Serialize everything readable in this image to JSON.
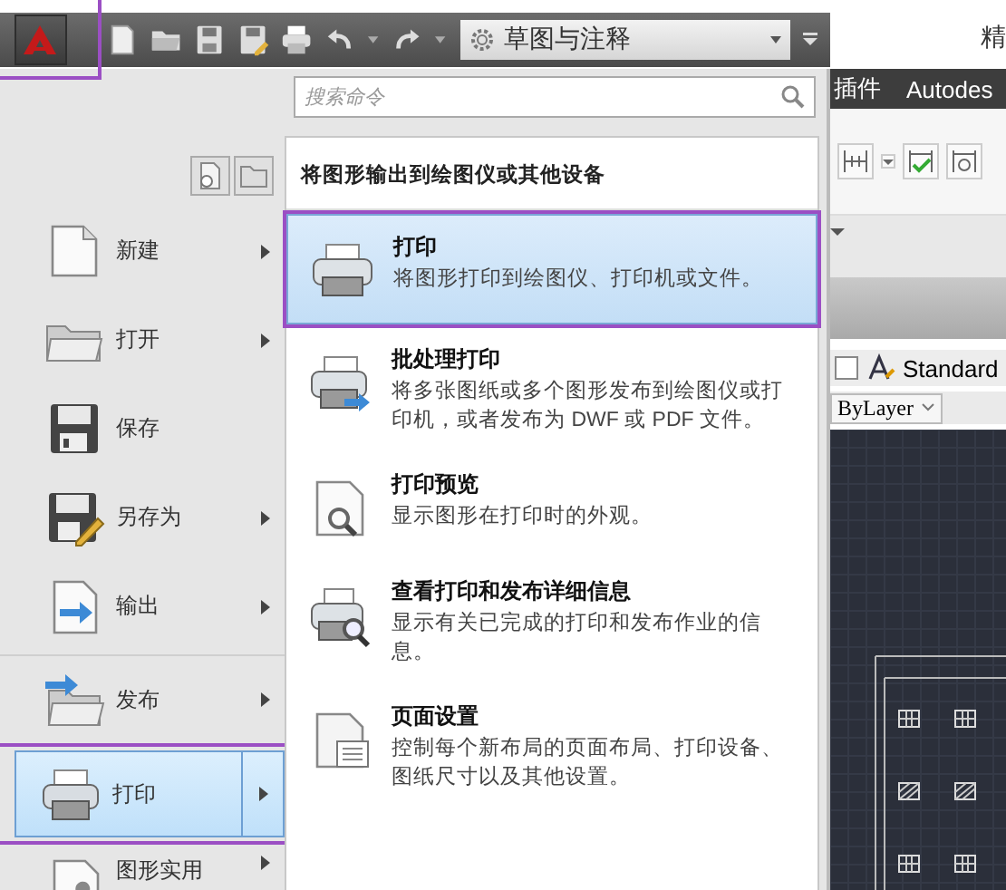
{
  "toolbar": {
    "workspace": "草图与注释",
    "title_fragment": "精"
  },
  "search": {
    "placeholder": "搜索命令"
  },
  "menu_items": [
    {
      "label": "新建",
      "submenu": true,
      "selected": false
    },
    {
      "label": "打开",
      "submenu": true,
      "selected": false
    },
    {
      "label": "保存",
      "submenu": false,
      "selected": false
    },
    {
      "label": "另存为",
      "submenu": true,
      "selected": false
    },
    {
      "label": "输出",
      "submenu": true,
      "selected": false
    },
    {
      "label": "发布",
      "submenu": true,
      "selected": false
    },
    {
      "label": "打印",
      "submenu": true,
      "selected": true
    },
    {
      "label": "图形实用",
      "submenu": true,
      "selected": false
    }
  ],
  "panel": {
    "heading": "将图形输出到绘图仪或其他设备",
    "items": [
      {
        "title": "打印",
        "description": "将图形打印到绘图仪、打印机或文件。",
        "selected": true
      },
      {
        "title": "批处理打印",
        "description": "将多张图纸或多个图形发布到绘图仪或打印机，或者发布为 DWF 或 PDF 文件。",
        "selected": false
      },
      {
        "title": "打印预览",
        "description": "显示图形在打印时的外观。",
        "selected": false
      },
      {
        "title": "查看打印和发布详细信息",
        "description": "显示有关已完成的打印和发布作业的信息。",
        "selected": false
      },
      {
        "title": "页面设置",
        "description": "控制每个新布局的页面布局、打印设备、图纸尺寸以及其他设置。",
        "selected": false
      }
    ]
  },
  "ribbon_tabs": [
    "插件",
    "Autodes"
  ],
  "text_style": "Standard",
  "layer": "ByLayer"
}
